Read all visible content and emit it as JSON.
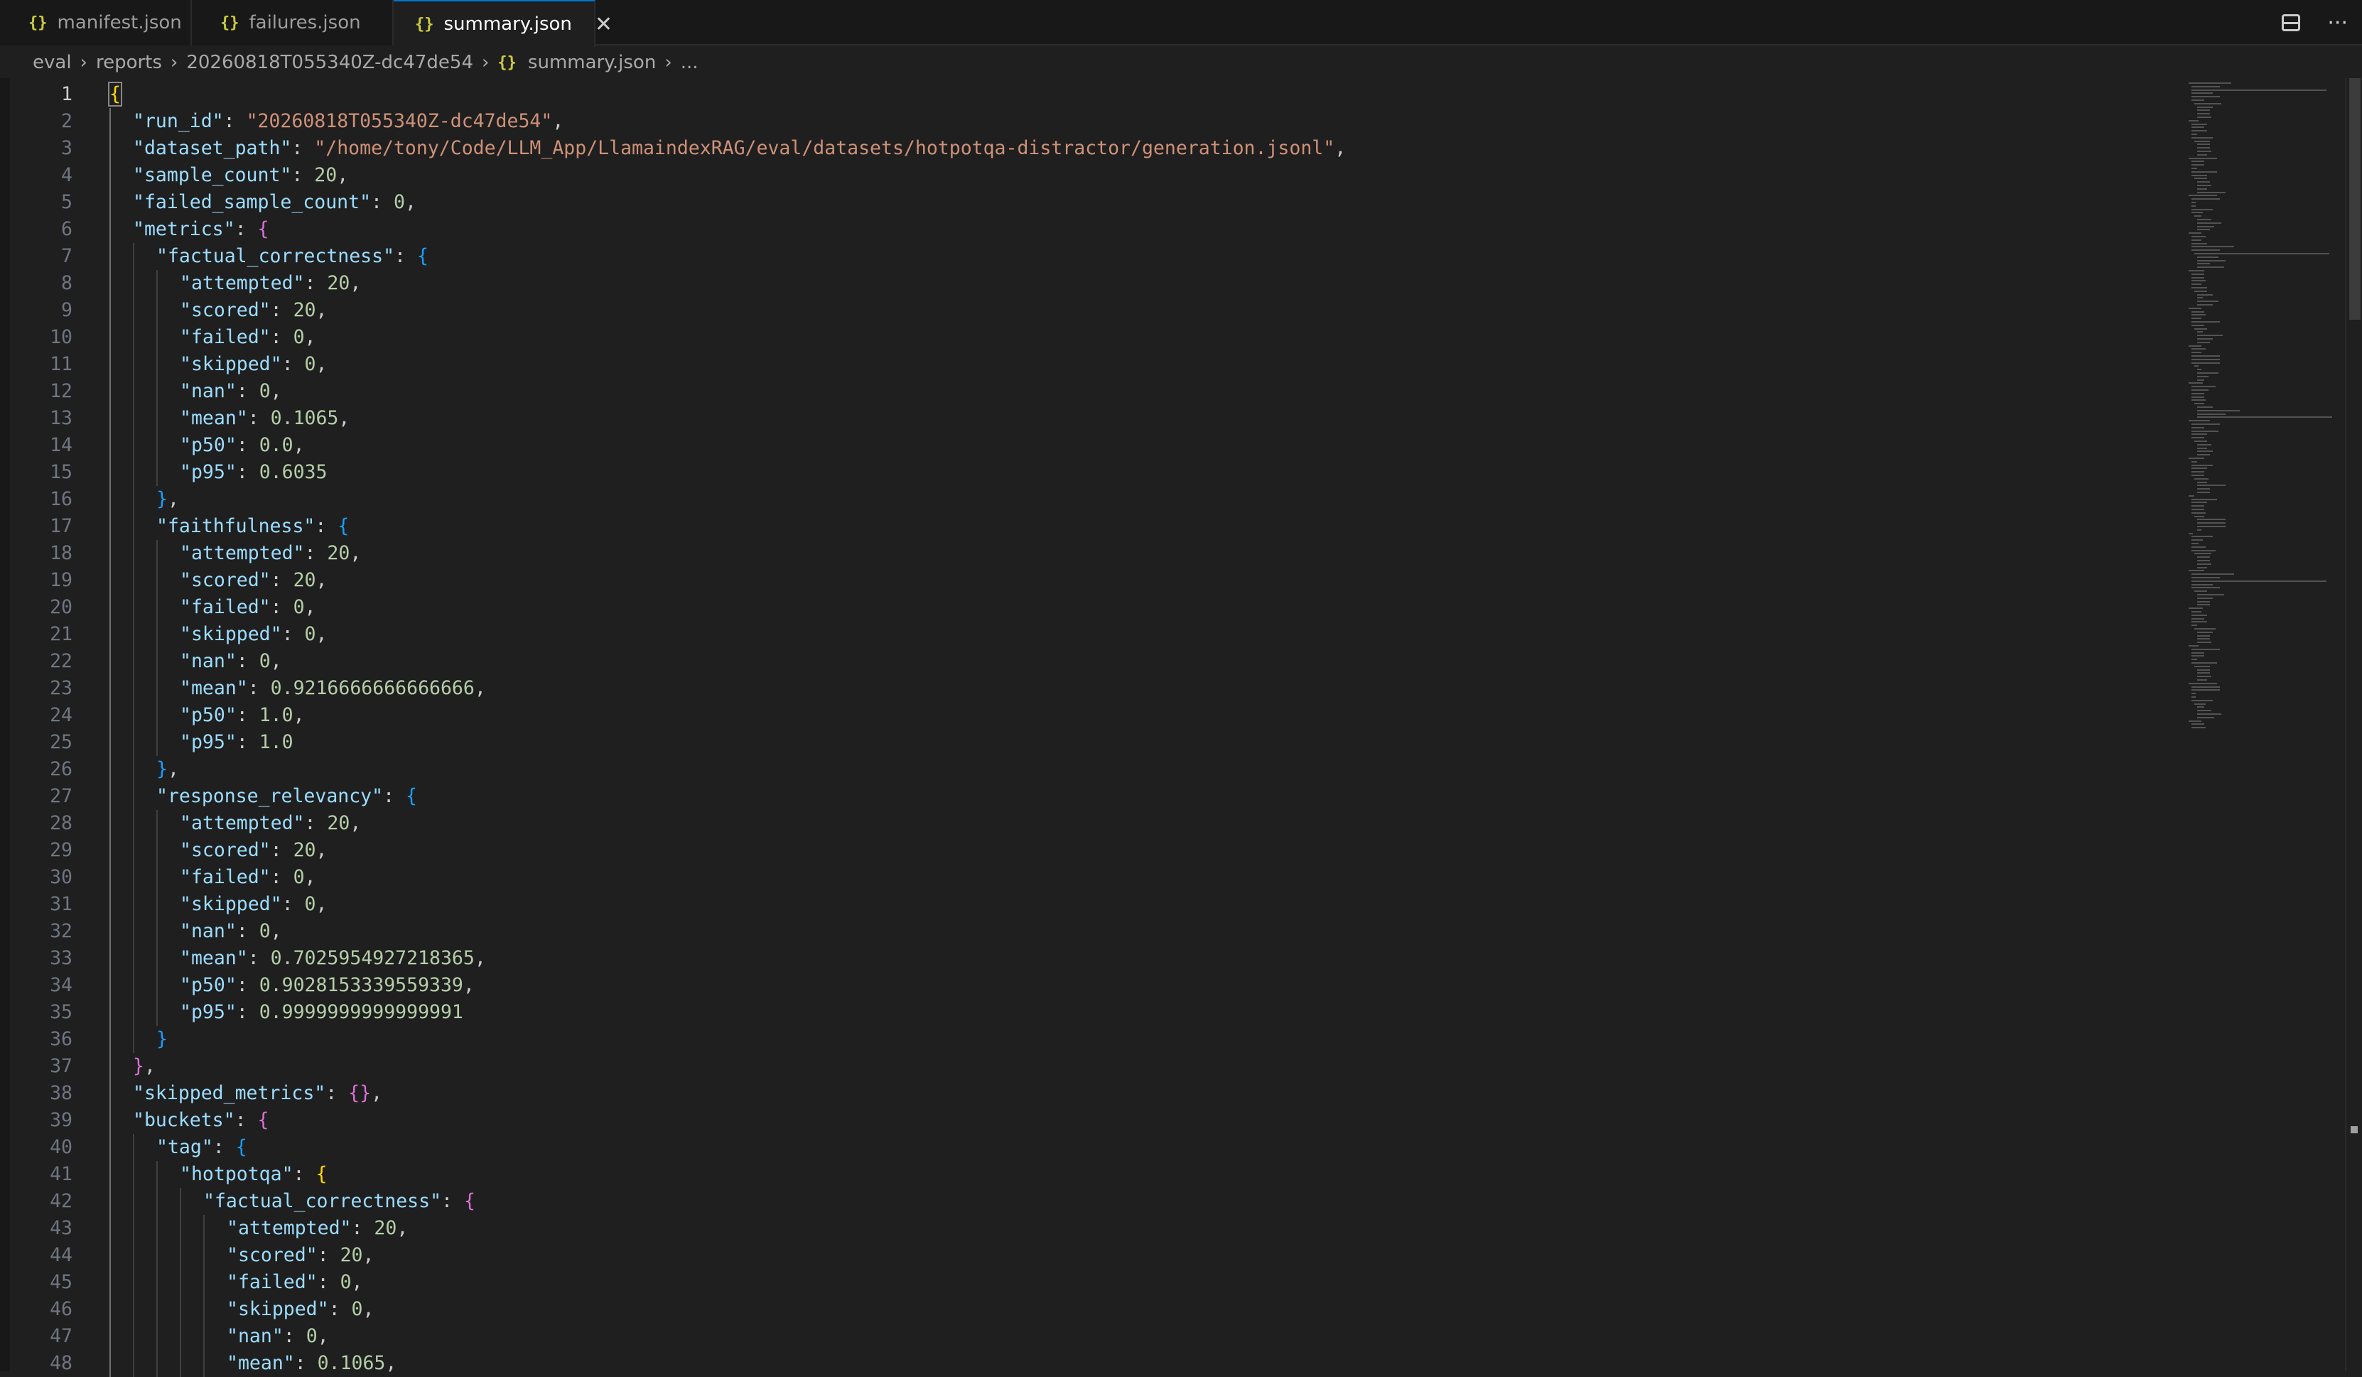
{
  "tabs": [
    {
      "icon": "{}",
      "label": "manifest.json",
      "active": false
    },
    {
      "icon": "{}",
      "label": "failures.json",
      "active": false
    },
    {
      "icon": "{}",
      "label": "summary.json",
      "active": true
    }
  ],
  "tab_actions": {
    "more": "···"
  },
  "breadcrumb": {
    "items": [
      "eval",
      "reports",
      "20260818T055340Z-dc47de54"
    ],
    "file_icon": "{}",
    "file": "summary.json",
    "tail": "..."
  },
  "editor": {
    "current_line": 1,
    "lines": [
      {
        "n": "1",
        "indent": 0,
        "parts": [
          [
            "b0",
            "{"
          ]
        ]
      },
      {
        "n": "2",
        "indent": 1,
        "parts": [
          [
            "k",
            "\"run_id\""
          ],
          [
            "p",
            ": "
          ],
          [
            "s",
            "\"20260818T055340Z-dc47de54\""
          ],
          [
            "p",
            ","
          ]
        ]
      },
      {
        "n": "3",
        "indent": 1,
        "parts": [
          [
            "k",
            "\"dataset_path\""
          ],
          [
            "p",
            ": "
          ],
          [
            "s",
            "\"/home/tony/Code/LLM_App/LlamaindexRAG/eval/datasets/hotpotqa-distractor/generation.jsonl\""
          ],
          [
            "p",
            ","
          ]
        ]
      },
      {
        "n": "4",
        "indent": 1,
        "parts": [
          [
            "k",
            "\"sample_count\""
          ],
          [
            "p",
            ": "
          ],
          [
            "n",
            "20"
          ],
          [
            "p",
            ","
          ]
        ]
      },
      {
        "n": "5",
        "indent": 1,
        "parts": [
          [
            "k",
            "\"failed_sample_count\""
          ],
          [
            "p",
            ": "
          ],
          [
            "n",
            "0"
          ],
          [
            "p",
            ","
          ]
        ]
      },
      {
        "n": "6",
        "indent": 1,
        "parts": [
          [
            "k",
            "\"metrics\""
          ],
          [
            "p",
            ": "
          ],
          [
            "b1",
            "{"
          ]
        ]
      },
      {
        "n": "7",
        "indent": 2,
        "parts": [
          [
            "k",
            "\"factual_correctness\""
          ],
          [
            "p",
            ": "
          ],
          [
            "b2",
            "{"
          ]
        ]
      },
      {
        "n": "8",
        "indent": 3,
        "parts": [
          [
            "k",
            "\"attempted\""
          ],
          [
            "p",
            ": "
          ],
          [
            "n",
            "20"
          ],
          [
            "p",
            ","
          ]
        ]
      },
      {
        "n": "9",
        "indent": 3,
        "parts": [
          [
            "k",
            "\"scored\""
          ],
          [
            "p",
            ": "
          ],
          [
            "n",
            "20"
          ],
          [
            "p",
            ","
          ]
        ]
      },
      {
        "n": "10",
        "indent": 3,
        "parts": [
          [
            "k",
            "\"failed\""
          ],
          [
            "p",
            ": "
          ],
          [
            "n",
            "0"
          ],
          [
            "p",
            ","
          ]
        ]
      },
      {
        "n": "11",
        "indent": 3,
        "parts": [
          [
            "k",
            "\"skipped\""
          ],
          [
            "p",
            ": "
          ],
          [
            "n",
            "0"
          ],
          [
            "p",
            ","
          ]
        ]
      },
      {
        "n": "12",
        "indent": 3,
        "parts": [
          [
            "k",
            "\"nan\""
          ],
          [
            "p",
            ": "
          ],
          [
            "n",
            "0"
          ],
          [
            "p",
            ","
          ]
        ]
      },
      {
        "n": "13",
        "indent": 3,
        "parts": [
          [
            "k",
            "\"mean\""
          ],
          [
            "p",
            ": "
          ],
          [
            "n",
            "0.1065"
          ],
          [
            "p",
            ","
          ]
        ]
      },
      {
        "n": "14",
        "indent": 3,
        "parts": [
          [
            "k",
            "\"p50\""
          ],
          [
            "p",
            ": "
          ],
          [
            "n",
            "0.0"
          ],
          [
            "p",
            ","
          ]
        ]
      },
      {
        "n": "15",
        "indent": 3,
        "parts": [
          [
            "k",
            "\"p95\""
          ],
          [
            "p",
            ": "
          ],
          [
            "n",
            "0.6035"
          ]
        ]
      },
      {
        "n": "16",
        "indent": 2,
        "parts": [
          [
            "b2",
            "}"
          ],
          [
            "p",
            ","
          ]
        ]
      },
      {
        "n": "17",
        "indent": 2,
        "parts": [
          [
            "k",
            "\"faithfulness\""
          ],
          [
            "p",
            ": "
          ],
          [
            "b2",
            "{"
          ]
        ]
      },
      {
        "n": "18",
        "indent": 3,
        "parts": [
          [
            "k",
            "\"attempted\""
          ],
          [
            "p",
            ": "
          ],
          [
            "n",
            "20"
          ],
          [
            "p",
            ","
          ]
        ]
      },
      {
        "n": "19",
        "indent": 3,
        "parts": [
          [
            "k",
            "\"scored\""
          ],
          [
            "p",
            ": "
          ],
          [
            "n",
            "20"
          ],
          [
            "p",
            ","
          ]
        ]
      },
      {
        "n": "20",
        "indent": 3,
        "parts": [
          [
            "k",
            "\"failed\""
          ],
          [
            "p",
            ": "
          ],
          [
            "n",
            "0"
          ],
          [
            "p",
            ","
          ]
        ]
      },
      {
        "n": "21",
        "indent": 3,
        "parts": [
          [
            "k",
            "\"skipped\""
          ],
          [
            "p",
            ": "
          ],
          [
            "n",
            "0"
          ],
          [
            "p",
            ","
          ]
        ]
      },
      {
        "n": "22",
        "indent": 3,
        "parts": [
          [
            "k",
            "\"nan\""
          ],
          [
            "p",
            ": "
          ],
          [
            "n",
            "0"
          ],
          [
            "p",
            ","
          ]
        ]
      },
      {
        "n": "23",
        "indent": 3,
        "parts": [
          [
            "k",
            "\"mean\""
          ],
          [
            "p",
            ": "
          ],
          [
            "n",
            "0.9216666666666666"
          ],
          [
            "p",
            ","
          ]
        ]
      },
      {
        "n": "24",
        "indent": 3,
        "parts": [
          [
            "k",
            "\"p50\""
          ],
          [
            "p",
            ": "
          ],
          [
            "n",
            "1.0"
          ],
          [
            "p",
            ","
          ]
        ]
      },
      {
        "n": "25",
        "indent": 3,
        "parts": [
          [
            "k",
            "\"p95\""
          ],
          [
            "p",
            ": "
          ],
          [
            "n",
            "1.0"
          ]
        ]
      },
      {
        "n": "26",
        "indent": 2,
        "parts": [
          [
            "b2",
            "}"
          ],
          [
            "p",
            ","
          ]
        ]
      },
      {
        "n": "27",
        "indent": 2,
        "parts": [
          [
            "k",
            "\"response_relevancy\""
          ],
          [
            "p",
            ": "
          ],
          [
            "b2",
            "{"
          ]
        ]
      },
      {
        "n": "28",
        "indent": 3,
        "parts": [
          [
            "k",
            "\"attempted\""
          ],
          [
            "p",
            ": "
          ],
          [
            "n",
            "20"
          ],
          [
            "p",
            ","
          ]
        ]
      },
      {
        "n": "29",
        "indent": 3,
        "parts": [
          [
            "k",
            "\"scored\""
          ],
          [
            "p",
            ": "
          ],
          [
            "n",
            "20"
          ],
          [
            "p",
            ","
          ]
        ]
      },
      {
        "n": "30",
        "indent": 3,
        "parts": [
          [
            "k",
            "\"failed\""
          ],
          [
            "p",
            ": "
          ],
          [
            "n",
            "0"
          ],
          [
            "p",
            ","
          ]
        ]
      },
      {
        "n": "31",
        "indent": 3,
        "parts": [
          [
            "k",
            "\"skipped\""
          ],
          [
            "p",
            ": "
          ],
          [
            "n",
            "0"
          ],
          [
            "p",
            ","
          ]
        ]
      },
      {
        "n": "32",
        "indent": 3,
        "parts": [
          [
            "k",
            "\"nan\""
          ],
          [
            "p",
            ": "
          ],
          [
            "n",
            "0"
          ],
          [
            "p",
            ","
          ]
        ]
      },
      {
        "n": "33",
        "indent": 3,
        "parts": [
          [
            "k",
            "\"mean\""
          ],
          [
            "p",
            ": "
          ],
          [
            "n",
            "0.7025954927218365"
          ],
          [
            "p",
            ","
          ]
        ]
      },
      {
        "n": "34",
        "indent": 3,
        "parts": [
          [
            "k",
            "\"p50\""
          ],
          [
            "p",
            ": "
          ],
          [
            "n",
            "0.9028153339559339"
          ],
          [
            "p",
            ","
          ]
        ]
      },
      {
        "n": "35",
        "indent": 3,
        "parts": [
          [
            "k",
            "\"p95\""
          ],
          [
            "p",
            ": "
          ],
          [
            "n",
            "0.9999999999999991"
          ]
        ]
      },
      {
        "n": "36",
        "indent": 2,
        "parts": [
          [
            "b2",
            "}"
          ]
        ]
      },
      {
        "n": "37",
        "indent": 1,
        "parts": [
          [
            "b1",
            "}"
          ],
          [
            "p",
            ","
          ]
        ]
      },
      {
        "n": "38",
        "indent": 1,
        "parts": [
          [
            "k",
            "\"skipped_metrics\""
          ],
          [
            "p",
            ": "
          ],
          [
            "b1",
            "{}"
          ],
          [
            "p",
            ","
          ]
        ]
      },
      {
        "n": "39",
        "indent": 1,
        "parts": [
          [
            "k",
            "\"buckets\""
          ],
          [
            "p",
            ": "
          ],
          [
            "b1",
            "{"
          ]
        ]
      },
      {
        "n": "40",
        "indent": 2,
        "parts": [
          [
            "k",
            "\"tag\""
          ],
          [
            "p",
            ": "
          ],
          [
            "b2",
            "{"
          ]
        ]
      },
      {
        "n": "41",
        "indent": 3,
        "parts": [
          [
            "k",
            "\"hotpotqa\""
          ],
          [
            "p",
            ": "
          ],
          [
            "b0",
            "{"
          ]
        ]
      },
      {
        "n": "42",
        "indent": 4,
        "parts": [
          [
            "k",
            "\"factual_correctness\""
          ],
          [
            "p",
            ": "
          ],
          [
            "b1",
            "{"
          ]
        ]
      },
      {
        "n": "43",
        "indent": 5,
        "parts": [
          [
            "k",
            "\"attempted\""
          ],
          [
            "p",
            ": "
          ],
          [
            "n",
            "20"
          ],
          [
            "p",
            ","
          ]
        ]
      },
      {
        "n": "44",
        "indent": 5,
        "parts": [
          [
            "k",
            "\"scored\""
          ],
          [
            "p",
            ": "
          ],
          [
            "n",
            "20"
          ],
          [
            "p",
            ","
          ]
        ]
      },
      {
        "n": "45",
        "indent": 5,
        "parts": [
          [
            "k",
            "\"failed\""
          ],
          [
            "p",
            ": "
          ],
          [
            "n",
            "0"
          ],
          [
            "p",
            ","
          ]
        ]
      },
      {
        "n": "46",
        "indent": 5,
        "parts": [
          [
            "k",
            "\"skipped\""
          ],
          [
            "p",
            ": "
          ],
          [
            "n",
            "0"
          ],
          [
            "p",
            ","
          ]
        ]
      },
      {
        "n": "47",
        "indent": 5,
        "parts": [
          [
            "k",
            "\"nan\""
          ],
          [
            "p",
            ": "
          ],
          [
            "n",
            "0"
          ],
          [
            "p",
            ","
          ]
        ]
      },
      {
        "n": "48",
        "indent": 5,
        "parts": [
          [
            "k",
            "\"mean\""
          ],
          [
            "p",
            ": "
          ],
          [
            "n",
            "0.1065"
          ],
          [
            "p",
            ","
          ]
        ]
      }
    ]
  },
  "colors": {
    "background": "#1f1f1f",
    "tabbar": "#181818",
    "key": "#9cdcfe",
    "string": "#ce9178",
    "number": "#b5cea8",
    "bracket_gold": "#ffd700",
    "bracket_purple": "#da70d6",
    "bracket_blue": "#179fff",
    "json_icon": "#cbcb41"
  }
}
